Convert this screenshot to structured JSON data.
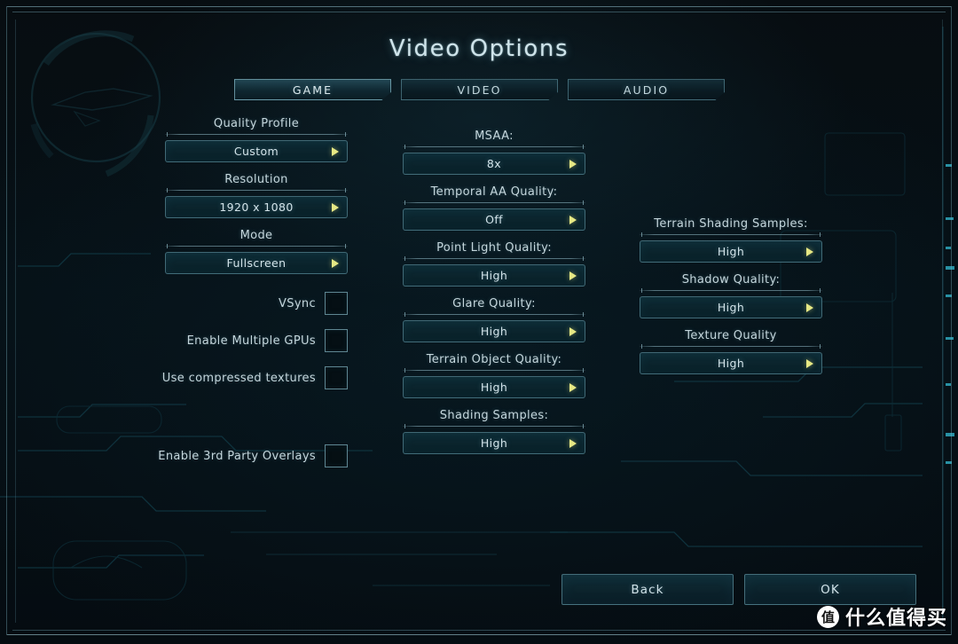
{
  "window": {
    "title": "Video Options"
  },
  "tabs": [
    {
      "label": "GAME",
      "active": true
    },
    {
      "label": "VIDEO",
      "active": false
    },
    {
      "label": "AUDIO",
      "active": false
    }
  ],
  "columns": {
    "left": {
      "dropdowns": [
        {
          "label": "Quality Profile",
          "value": "Custom",
          "arrow_icon": "triangle-right-icon"
        },
        {
          "label": "Resolution",
          "value": "1920 x 1080",
          "arrow_icon": "triangle-right-icon"
        },
        {
          "label": "Mode",
          "value": "Fullscreen",
          "arrow_icon": "triangle-right-icon"
        }
      ],
      "checkboxes": [
        {
          "label": "VSync",
          "checked": false
        },
        {
          "label": "Enable Multiple GPUs",
          "checked": false
        },
        {
          "label": "Use compressed textures",
          "checked": false
        },
        {
          "label": "Enable 3rd Party Overlays",
          "checked": false
        }
      ]
    },
    "middle": {
      "dropdowns": [
        {
          "label": "MSAA:",
          "value": "8x",
          "arrow_icon": "triangle-right-icon"
        },
        {
          "label": "Temporal AA Quality:",
          "value": "Off",
          "arrow_icon": "triangle-right-icon"
        },
        {
          "label": "Point Light Quality:",
          "value": "High",
          "arrow_icon": "triangle-right-icon"
        },
        {
          "label": "Glare Quality:",
          "value": "High",
          "arrow_icon": "triangle-right-icon"
        },
        {
          "label": "Terrain Object Quality:",
          "value": "High",
          "arrow_icon": "triangle-right-icon"
        },
        {
          "label": "Shading Samples:",
          "value": "High",
          "arrow_icon": "triangle-right-icon"
        }
      ]
    },
    "right": {
      "dropdowns": [
        {
          "label": "Terrain Shading Samples:",
          "value": "High",
          "arrow_icon": "triangle-right-icon"
        },
        {
          "label": "Shadow Quality:",
          "value": "High",
          "arrow_icon": "triangle-right-icon"
        },
        {
          "label": "Texture Quality",
          "value": "High",
          "arrow_icon": "triangle-right-icon"
        }
      ]
    }
  },
  "footer": {
    "back_label": "Back",
    "ok_label": "OK"
  },
  "watermark": {
    "badge": "值",
    "text": "什么值得买"
  },
  "colors": {
    "accent_arrow": "#e6e884",
    "text_primary": "#d2e3e9",
    "text_label": "#c4d6dc",
    "panel_fill": "#0b2028",
    "panel_border": "#628f9f",
    "background": "#061016"
  }
}
